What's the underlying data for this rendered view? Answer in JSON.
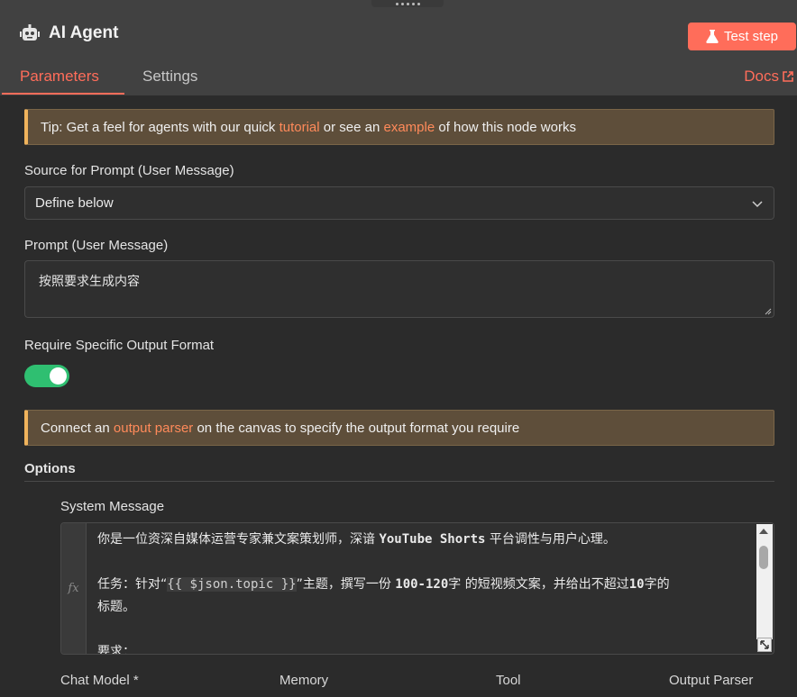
{
  "header": {
    "title": "AI Agent",
    "test_step_label": "Test step",
    "tabs": [
      {
        "label": "Parameters",
        "active": true
      },
      {
        "label": "Settings",
        "active": false
      }
    ],
    "docs_label": "Docs"
  },
  "tip": {
    "before": "Tip: Get a feel for agents with our quick ",
    "link1": "tutorial",
    "middle": " or see an ",
    "link2": "example",
    "after": " of how this node works"
  },
  "source_prompt": {
    "label": "Source for Prompt (User Message)",
    "value": "Define below"
  },
  "prompt": {
    "label": "Prompt (User Message)",
    "value": "按照要求生成内容"
  },
  "output_format": {
    "label": "Require Specific Output Format",
    "enabled": true
  },
  "parser_notice": {
    "before": "Connect an ",
    "link": "output parser",
    "after": " on the canvas to specify the output format you require"
  },
  "options": {
    "title": "Options",
    "system_message": {
      "label": "System Message",
      "fx": "fx",
      "line1_a": "你是一位资深自媒体运营专家兼文案策划师，深谙 ",
      "line1_b": "YouTube Shorts",
      "line1_c": " 平台调性与用户心理。",
      "line2_a": "任务：针对“",
      "line2_expr": "{{ $json.topic }}",
      "line2_b": "”主题，撰写一份 ",
      "line2_c": "100-120",
      "line2_d": "字 的短视频文案，并给出不超过",
      "line2_e": "10",
      "line2_f": "字的",
      "line3": "标题。",
      "line4": "要求："
    }
  },
  "sub_nodes": {
    "chat_model": "Chat Model *",
    "memory": "Memory",
    "tool": "Tool",
    "output_parser": "Output Parser"
  },
  "colors": {
    "accent": "#ff6d5a",
    "toggle_on": "#2fbf71",
    "callout_bg": "#5e4e3a",
    "callout_border": "#f0b35c"
  }
}
